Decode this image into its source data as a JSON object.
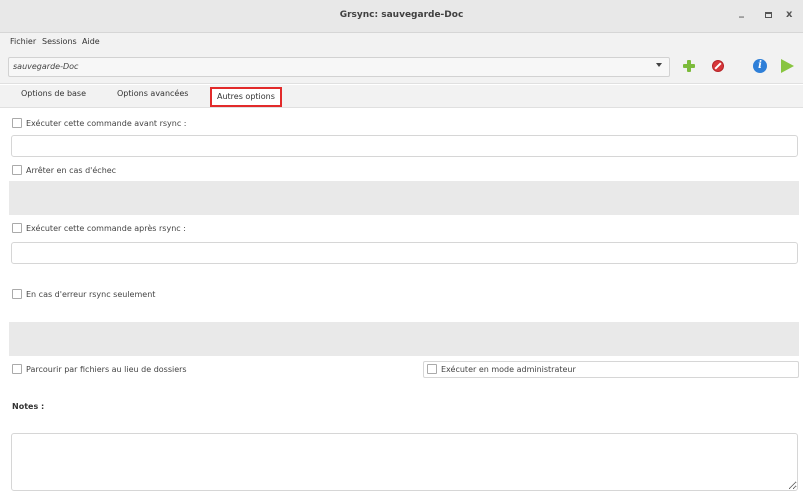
{
  "window": {
    "title": "Grsync: sauvegarde-Doc",
    "minimize_label": "_",
    "close_label": "x"
  },
  "menu": {
    "items": [
      "Fichier",
      "Sessions",
      "Aide"
    ]
  },
  "toolbar": {
    "session_value": "sauvegarde-Doc",
    "icons": [
      "add-session-icon",
      "delete-session-icon",
      "info-icon",
      "run-icon"
    ],
    "info_glyph": "i",
    "colors": {
      "add": "#7cbb3b",
      "delete": "#d7373a",
      "info": "#2e7fd8",
      "run": "#88c540"
    }
  },
  "tabs": {
    "items": [
      "Options de base",
      "Options avancées",
      "Autres options"
    ],
    "active_index": 2,
    "highlight_color": "#e22a2a"
  },
  "form": {
    "before_command_label": "Exécuter cette commande avant rsync :",
    "before_command_value": "",
    "stop_on_failure_label": "Arrêter en cas d'échec",
    "after_command_label": "Exécuter cette commande après rsync :",
    "after_command_value": "",
    "on_rsync_error_label": "En cas d'erreur rsync seulement",
    "browse_files_label": "Parcourir par fichiers au lieu de dossiers",
    "run_as_admin_label": "Exécuter en mode administrateur",
    "notes_label": "Notes :",
    "notes_value": ""
  }
}
